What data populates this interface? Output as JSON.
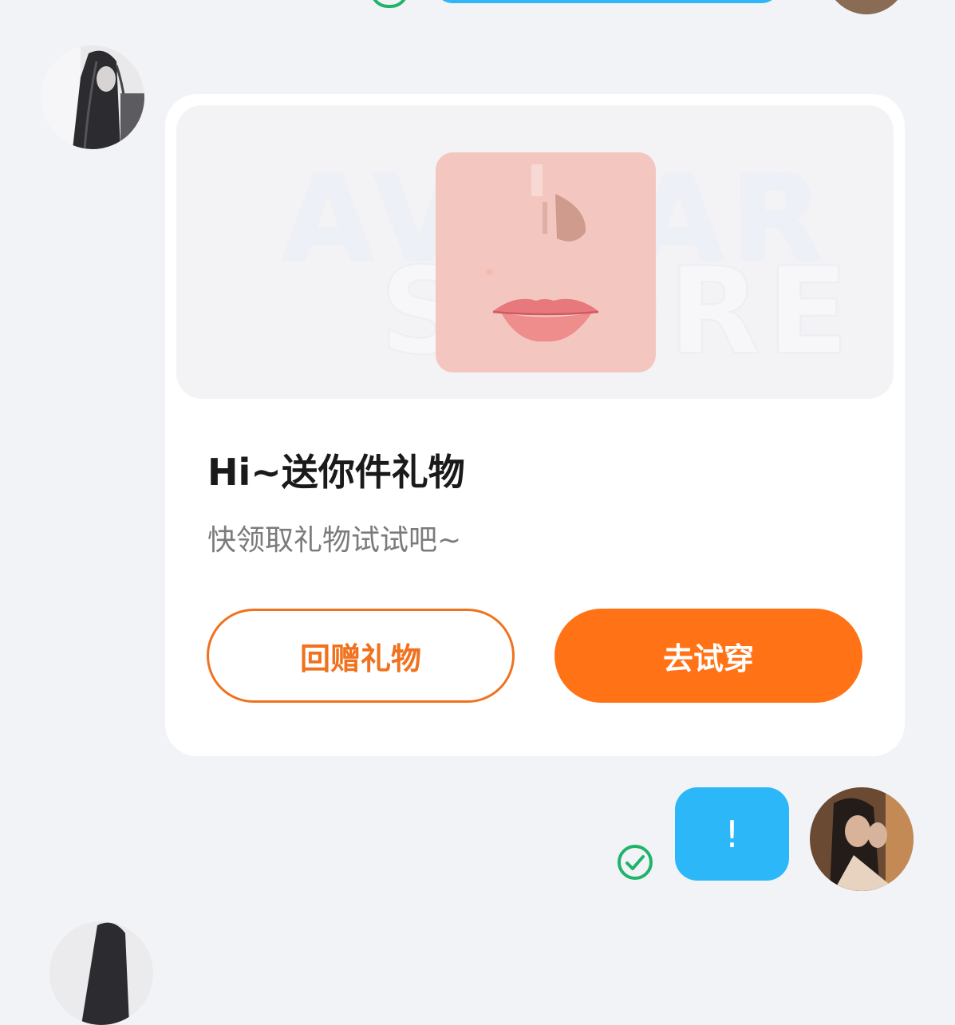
{
  "top_message": {
    "status_icon": "check-circle-icon"
  },
  "gift_card": {
    "preview_watermark_line1": "AVATAR",
    "preview_watermark_line2": "STORE",
    "title": "Hi~送你件礼物",
    "subtitle": "快领取礼物试试吧~",
    "return_gift_label": "回赠礼物",
    "try_on_label": "去试穿",
    "accent_color": "#ff7316"
  },
  "sent_message": {
    "text": "!",
    "bubble_color": "#2cb8f8",
    "status_icon": "check-circle-icon",
    "status_color": "#1fb36b"
  }
}
